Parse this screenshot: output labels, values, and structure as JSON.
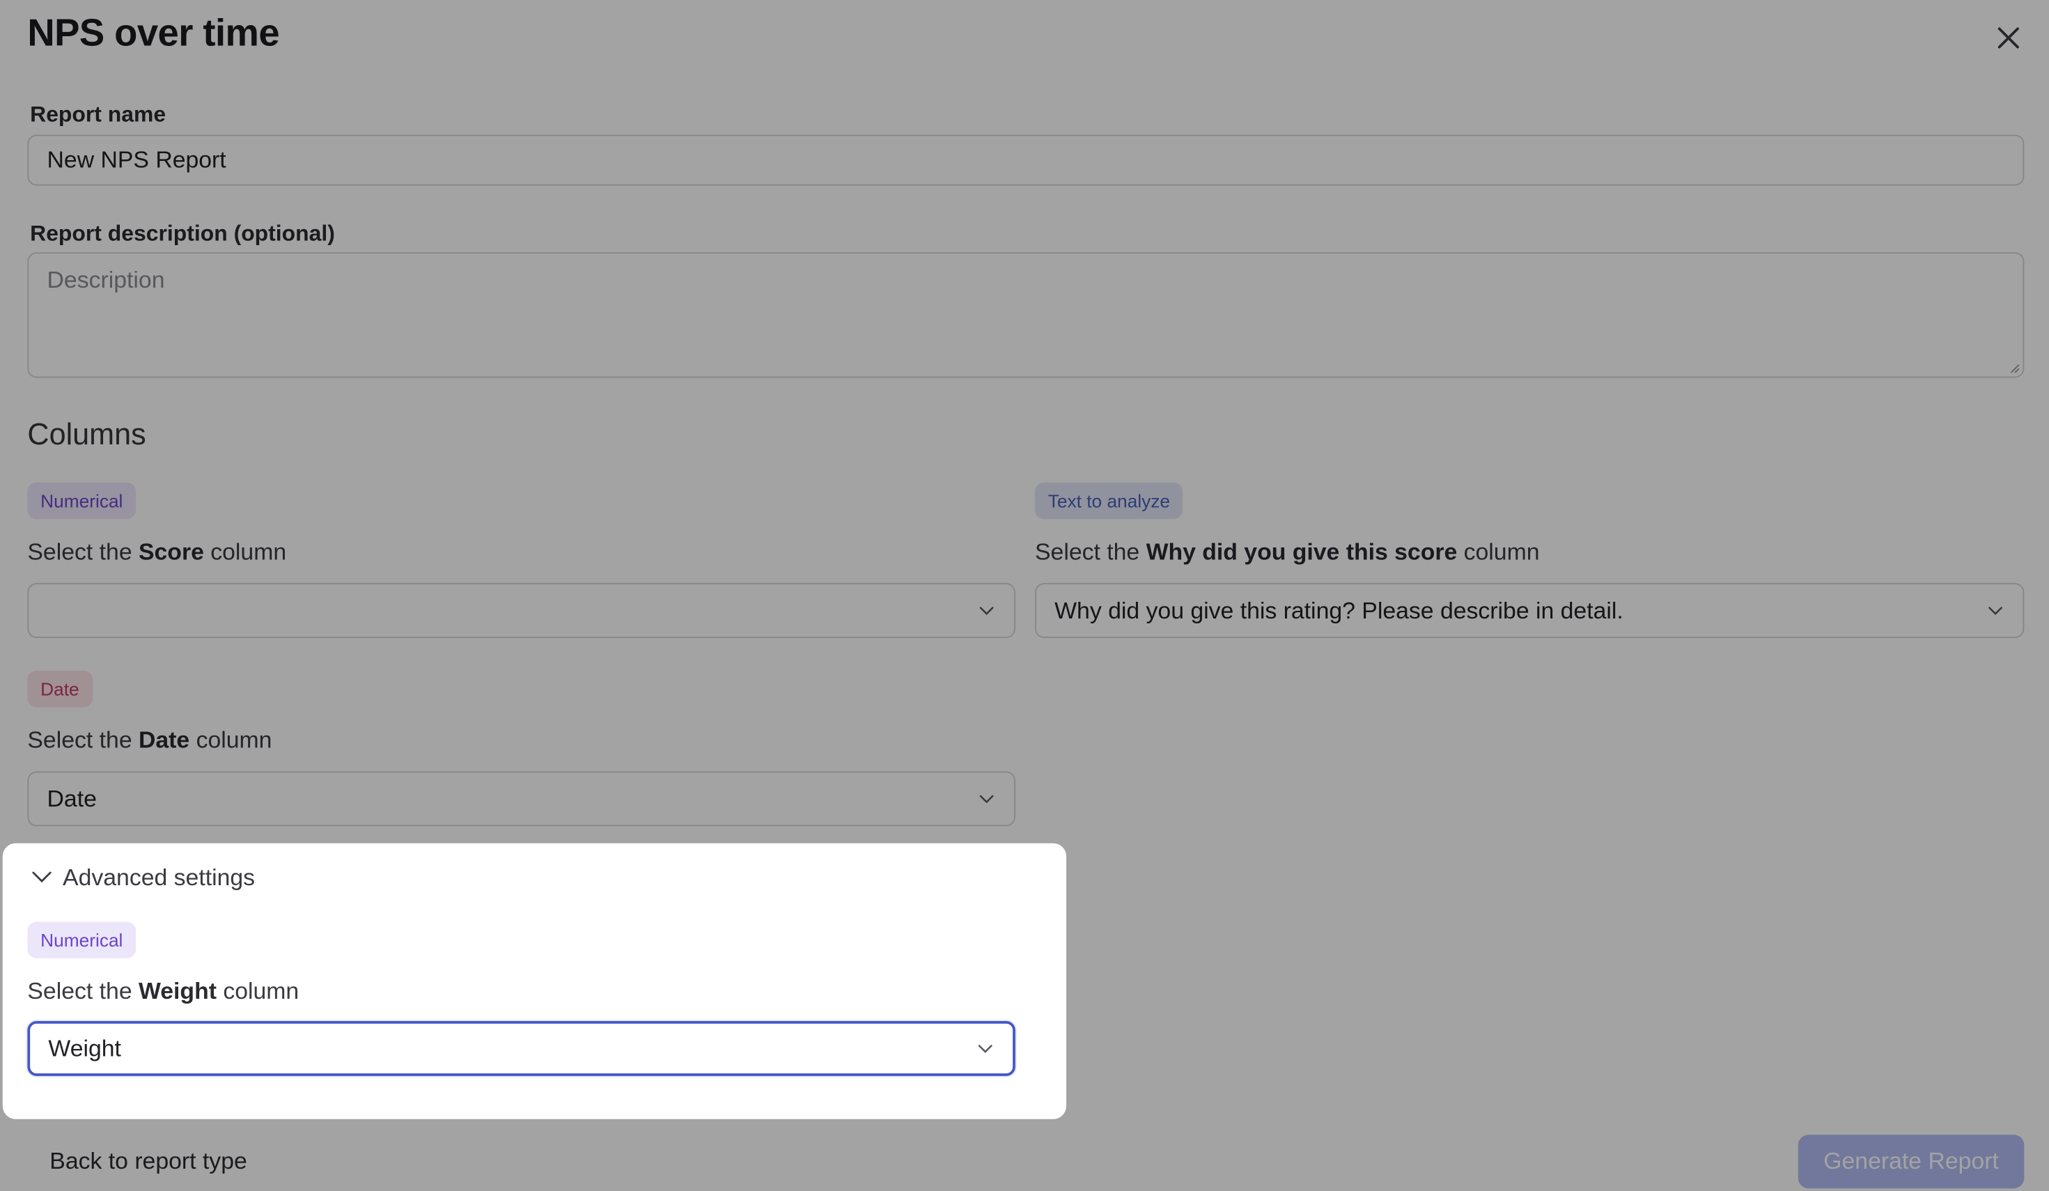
{
  "dialog": {
    "title": "NPS over time",
    "close_icon": "close-icon"
  },
  "report_name": {
    "label": "Report name",
    "value": "New NPS Report"
  },
  "report_description": {
    "label": "Report description (optional)",
    "placeholder": "Description",
    "value": ""
  },
  "columns": {
    "heading": "Columns",
    "score": {
      "chip": "Numerical",
      "label_prefix": "Select the ",
      "label_bold": "Score",
      "label_suffix": " column",
      "value": ""
    },
    "why": {
      "chip": "Text to analyze",
      "label_prefix": "Select the ",
      "label_bold": "Why did you give this score",
      "label_suffix": " column",
      "value": "Why did you give this rating? Please describe in detail."
    },
    "date": {
      "chip": "Date",
      "label_prefix": "Select the ",
      "label_bold": "Date",
      "label_suffix": " column",
      "value": "Date"
    }
  },
  "advanced": {
    "toggle_label": "Advanced settings",
    "expanded": true,
    "weight": {
      "chip": "Numerical",
      "label_prefix": "Select the ",
      "label_bold": "Weight",
      "label_suffix": " column",
      "value": "Weight"
    }
  },
  "footer": {
    "back_label": "Back to report type",
    "generate_label": "Generate Report"
  },
  "colors": {
    "accent": "#4457c9",
    "generate_button": "#b2bcf2",
    "chip_numerical_bg": "#ece6fa",
    "chip_numerical_text": "#6b45c9",
    "chip_text_bg": "#e2e7f6",
    "chip_text_text": "#4a5db8",
    "chip_date_bg": "#fbe3ea",
    "chip_date_text": "#c13a6a",
    "overlay": "rgba(0,0,0,0.36)"
  }
}
